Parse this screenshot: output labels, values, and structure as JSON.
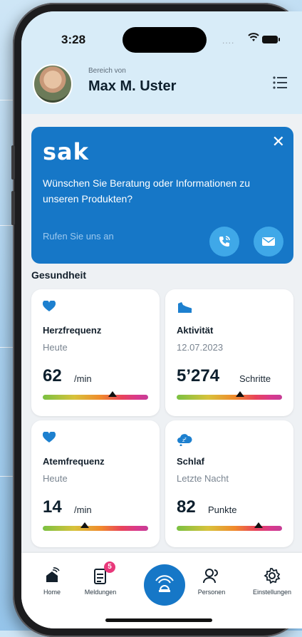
{
  "status_bar": {
    "time": "3:28",
    "dots": "...."
  },
  "header": {
    "area_label": "Bereich von",
    "user_name": "Max M. Uster"
  },
  "promo": {
    "logo": "sak",
    "text": "Wünschen Sie Beratung oder Informationen zu unseren Produkten?",
    "call_text": "Rufen Sie uns an"
  },
  "health": {
    "section_title": "Gesundheit",
    "cards": [
      {
        "title": "Herzfrequenz",
        "sub": "Heute",
        "value": "62",
        "unit": "/min",
        "marker_pos": 0.66
      },
      {
        "title": "Aktivität",
        "sub": "12.07.2023",
        "value": "5’274",
        "unit": "Schritte",
        "marker_pos": 0.6
      },
      {
        "title": "Atemfrequenz",
        "sub": "Heute",
        "value": "14",
        "unit": "/min",
        "marker_pos": 0.4
      },
      {
        "title": "Schlaf",
        "sub": "Letzte Nacht",
        "value": "82",
        "unit": "Punkte",
        "marker_pos": 0.78
      }
    ]
  },
  "tabbar": {
    "home": "Home",
    "notifications": "Meldungen",
    "notifications_badge": "5",
    "persons": "Personen",
    "settings": "Einstellungen"
  },
  "colors": {
    "brand_blue": "#1677c7",
    "heart": "#1d80cf"
  }
}
